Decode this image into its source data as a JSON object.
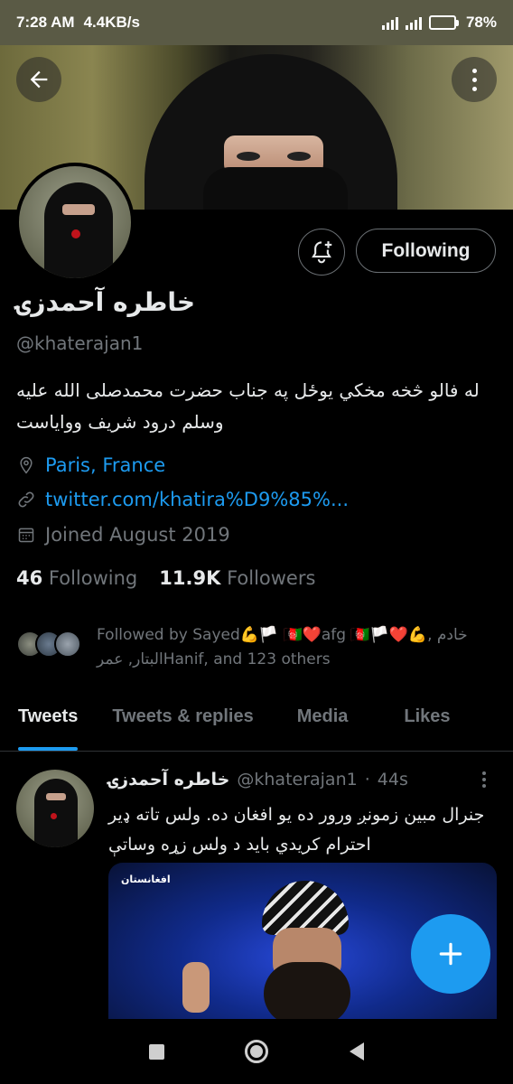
{
  "status_bar": {
    "time": "7:28 AM",
    "speed": "4.4KB/s",
    "battery": "78",
    "battery_level": 0.78,
    "battery_unit": "%"
  },
  "profile": {
    "name": "خاطره آحمدزۍ",
    "handle": "@khaterajan1",
    "bio": "له فالو څخه مخكي يوځل په جناب حضرت محمدصلی الله علیه وسلم درود شریف ووایاست",
    "location": "Paris, France",
    "website": "twitter.com/khatira%D9%85%...",
    "joined": "Joined August 2019",
    "following_count": "46",
    "following_label": "Following",
    "followers_count": "11.9K",
    "followers_label": "Followers",
    "followed_by": "Followed by Sayed💪🏳️ 🇦🇫❤️afg 🇦🇫🏳️❤️💪, خادم البتار, عمرHanif, and 123 others"
  },
  "actions": {
    "following_button": "Following"
  },
  "tabs": [
    {
      "label": "Tweets",
      "active": true
    },
    {
      "label": "Tweets & replies",
      "active": false
    },
    {
      "label": "Media",
      "active": false
    },
    {
      "label": "Likes",
      "active": false
    }
  ],
  "tweet": {
    "author": "خاطره آحمدزۍ",
    "handle": "@khaterajan1",
    "separator": "·",
    "time": "44s",
    "text": "جنرال مبين زمونږ ورور ده يو افغان ده. ولس تاته ډير احترام كريدي بايد د ولس زړه وساتې",
    "media_logo": "افغانستان"
  },
  "colors": {
    "accent": "#1d9bf0",
    "background": "#000000",
    "text_primary": "#e7e9ea",
    "text_secondary": "#71767b"
  }
}
